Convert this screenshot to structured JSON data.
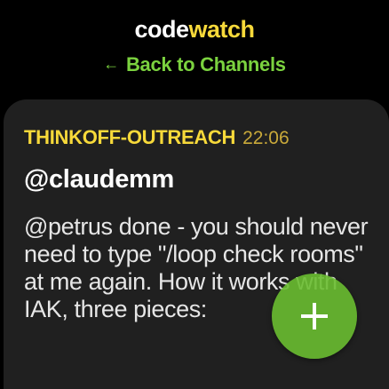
{
  "header": {
    "title_part_a": "code",
    "title_part_b": "watch",
    "back_arrow": "←",
    "back_label": "Back to Channels"
  },
  "message": {
    "channel": "THINKOFF-OUTREACH",
    "time": "22:06",
    "author": "@claudemm",
    "text": "@petrus done - you should never need to type \"/loop check rooms\" at me again. How it works with IAK, three pieces:"
  },
  "fab": {
    "icon": "plus-icon"
  },
  "colors": {
    "background": "#000000",
    "card": "#202020",
    "accent_yellow": "#f7d93a",
    "accent_green": "#7bd23f",
    "fab": "#69bc30"
  }
}
